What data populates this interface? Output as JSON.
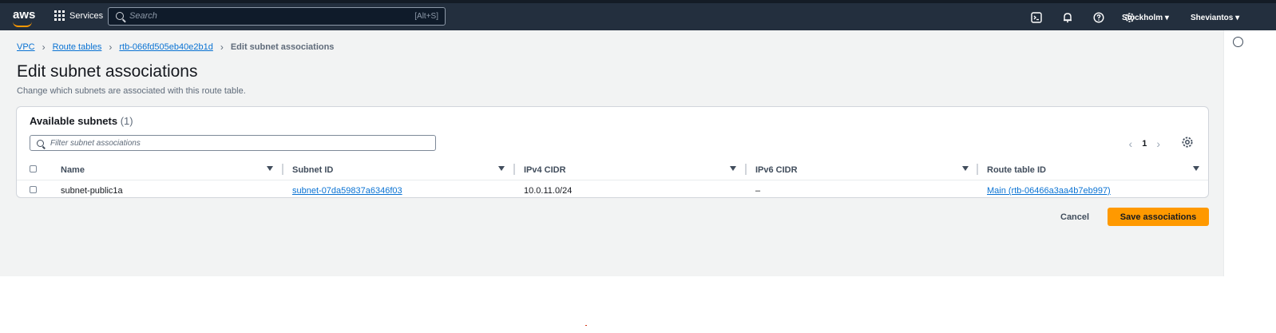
{
  "topbar": {
    "logo": "aws",
    "services": "Services",
    "search_placeholder": "Search",
    "search_shortcut": "[Alt+S]",
    "region": "Stockholm ▾",
    "user": "Sheviantos ▾"
  },
  "breadcrumb": [
    "VPC",
    "Route tables",
    "rtb-066fd505eb40e2b1d",
    "Edit subnet associations"
  ],
  "page": {
    "title": "Edit subnet associations",
    "description": "Change which subnets are associated with this route table."
  },
  "panel": {
    "title": "Available subnets",
    "count": "(1)",
    "filter_placeholder": "Filter subnet associations",
    "page_number": "1"
  },
  "table": {
    "headers": [
      "Name",
      "Subnet ID",
      "IPv4 CIDR",
      "IPv6 CIDR",
      "Route table ID"
    ],
    "rows": [
      {
        "name": "subnet-public1a",
        "subnet_id": "subnet-07da59837a6346f03",
        "ipv4": "10.0.11.0/24",
        "ipv6": "–",
        "route_table": "Main (rtb-06466a3aa4b7eb997)"
      }
    ]
  },
  "actions": {
    "cancel": "Cancel",
    "save": "Save associations"
  },
  "colors": {
    "topbar": "#232f3e",
    "link": "#0972d3",
    "primary_button": "#ff9900"
  }
}
